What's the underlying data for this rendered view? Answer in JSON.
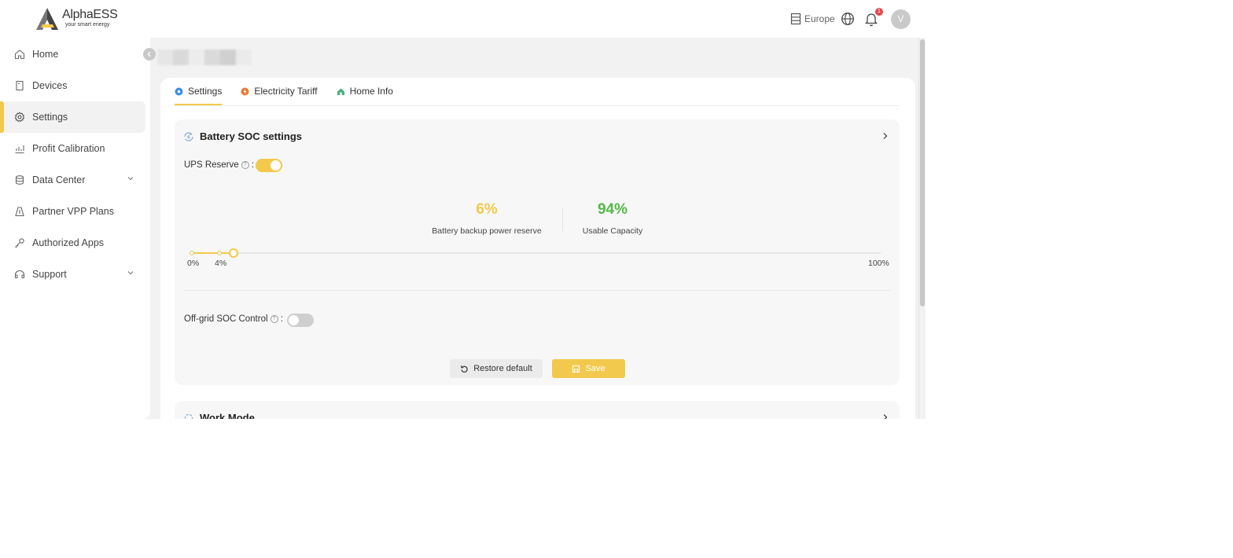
{
  "brand": {
    "name": "AlphaESS",
    "tagline": "your smart energy",
    "accent_color": "#f2c94c"
  },
  "sidebar": {
    "items": [
      {
        "label": "Home",
        "icon": "home-icon"
      },
      {
        "label": "Devices",
        "icon": "device-icon"
      },
      {
        "label": "Settings",
        "icon": "gear-icon",
        "active": true
      },
      {
        "label": "Profit Calibration",
        "icon": "chart-icon"
      },
      {
        "label": "Data Center",
        "icon": "database-icon",
        "expandable": true
      },
      {
        "label": "Partner VPP Plans",
        "icon": "plan-icon"
      },
      {
        "label": "Authorized Apps",
        "icon": "key-icon"
      },
      {
        "label": "Support",
        "icon": "support-icon",
        "expandable": true
      }
    ]
  },
  "header": {
    "region": "Europe",
    "notification_count": "1",
    "avatar_initial": "V"
  },
  "tabs": [
    {
      "label": "Settings",
      "active": true,
      "icon_color": "#3a8ee6"
    },
    {
      "label": "Electricity Tariff",
      "icon_color": "#e8793a"
    },
    {
      "label": "Home Info",
      "icon_color": "#4caf7d"
    }
  ],
  "battery_soc": {
    "title": "Battery SOC settings",
    "ups_reserve_label": "UPS Reserve",
    "ups_reserve_enabled": true,
    "backup_reserve_value": "6%",
    "backup_reserve_label": "Battery backup power reserve",
    "usable_capacity_value": "94%",
    "usable_capacity_label": "Usable Capacity",
    "reserve_value_color": "#f2c94c",
    "usable_value_color": "#52b946",
    "slider": {
      "min_label": "0%",
      "marker_label": "4%",
      "max_label": "100%",
      "marker_percent": 4,
      "reserve_percent": 6
    },
    "offgrid_label": "Off-grid SOC Control",
    "offgrid_enabled": false,
    "restore_label": "Restore default",
    "save_label": "Save"
  },
  "work_mode": {
    "title": "Work Mode"
  }
}
